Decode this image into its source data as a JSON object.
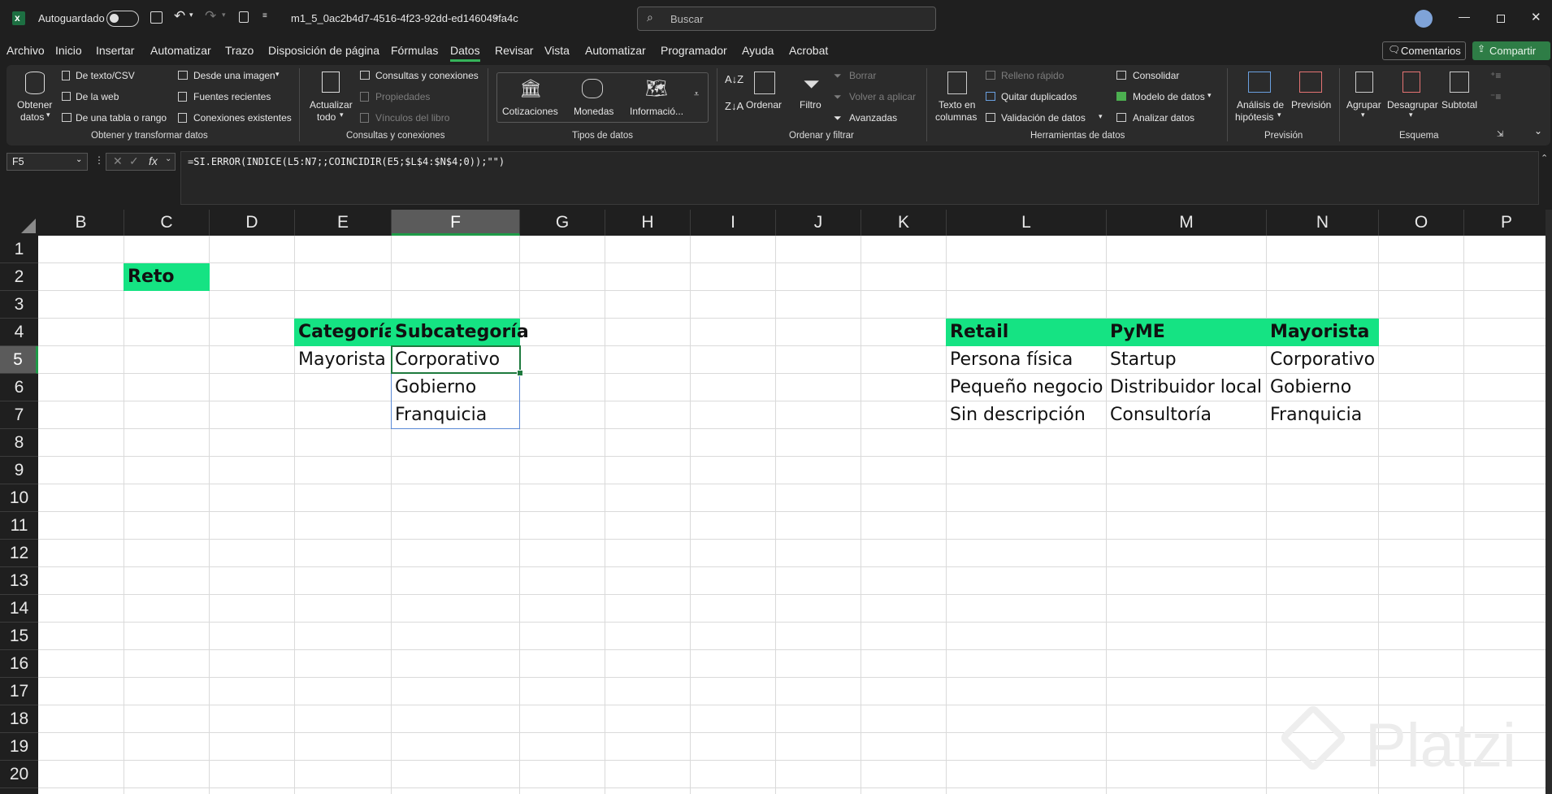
{
  "titlebar": {
    "autosave_label": "Autoguardado",
    "filename": "m1_5_0ac2b4d7-4516-4f23-92dd-ed146049fa4c",
    "search_placeholder": "Buscar"
  },
  "menu": [
    "Archivo",
    "Inicio",
    "Insertar",
    "Automatizar",
    "Trazo",
    "Disposición de página",
    "Fórmulas",
    "Datos",
    "Revisar",
    "Vista",
    "Automatizar",
    "Programador",
    "Ayuda",
    "Acrobat"
  ],
  "menu_active": "Datos",
  "actions": {
    "comments": "Comentarios",
    "share": "Compartir"
  },
  "ribbon": {
    "get_data": {
      "obtener_line1": "Obtener",
      "obtener_line2": "datos",
      "text_csv": "De texto/CSV",
      "web": "De la web",
      "table_range": "De una tabla o rango",
      "from_image": "Desde una imagen",
      "recent_sources": "Fuentes recientes",
      "existing_conn": "Conexiones existentes",
      "group": "Obtener y transformar datos"
    },
    "queries": {
      "refresh_line1": "Actualizar",
      "refresh_line2": "todo",
      "queries_conn": "Consultas y conexiones",
      "properties": "Propiedades",
      "workbook_links": "Vínculos del libro",
      "group": "Consultas y conexiones"
    },
    "data_types": {
      "stocks": "Cotizaciones",
      "currencies": "Monedas",
      "info": "Informació...",
      "group": "Tipos de datos"
    },
    "sort_filter": {
      "sort": "Ordenar",
      "filter": "Filtro",
      "clear": "Borrar",
      "reapply": "Volver a aplicar",
      "advanced": "Avanzadas",
      "group": "Ordenar y filtrar"
    },
    "data_tools": {
      "text_cols_line1": "Texto en",
      "text_cols_line2": "columnas",
      "flash_fill": "Relleno rápido",
      "remove_dup": "Quitar duplicados",
      "validation": "Validación de datos",
      "consolidate": "Consolidar",
      "data_model": "Modelo de datos",
      "analyze": "Analizar datos",
      "group": "Herramientas de datos"
    },
    "forecast": {
      "whatif_line1": "Análisis de",
      "whatif_line2": "hipótesis",
      "forecast": "Previsión",
      "group": "Previsión"
    },
    "outline": {
      "group_btn": "Agrupar",
      "ungroup_btn": "Desagrupar",
      "subtotal": "Subtotal",
      "group": "Esquema"
    }
  },
  "formula_bar": {
    "name_box": "F5",
    "formula": "=SI.ERROR(INDICE(L5:N7;;COINCIDIR(E5;$L$4:$N$4;0));\"\")"
  },
  "sheet": {
    "columns": [
      "B",
      "C",
      "D",
      "E",
      "F",
      "G",
      "H",
      "I",
      "J",
      "K",
      "L",
      "M",
      "N",
      "O",
      "P"
    ],
    "rows": [
      "1",
      "2",
      "3",
      "4",
      "5",
      "6",
      "7",
      "8",
      "9",
      "10",
      "11",
      "12",
      "13",
      "14",
      "15",
      "16",
      "17",
      "18",
      "19",
      "20"
    ],
    "selected_col": "F",
    "selected_row": "5",
    "cells": {
      "C2": "Reto",
      "E4": "Categoría",
      "F4": "Subcategoría",
      "E5": "Mayorista",
      "F5": "Corporativo",
      "F6": "Gobierno",
      "F7": "Franquicia",
      "L4": "Retail",
      "M4": "PyME",
      "N4": "Mayorista",
      "L5": "Persona física",
      "M5": "Startup",
      "N5": "Corporativo",
      "L6": "Pequeño negocio",
      "M6": "Distribuidor local",
      "N6": "Gobierno",
      "L7": "Sin descripción",
      "M7": "Consultoría",
      "N7": "Franquicia"
    }
  },
  "watermark": "Platzi",
  "colors": {
    "header_fill": "#15e383",
    "accent_green": "#1e9a47"
  }
}
